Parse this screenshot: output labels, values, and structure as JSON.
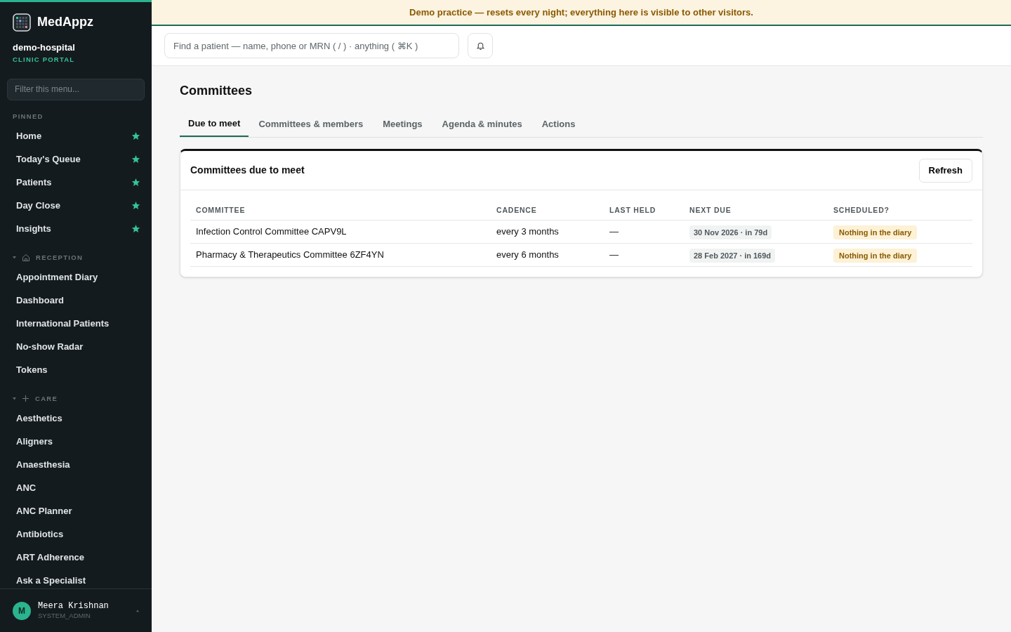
{
  "sidebar": {
    "brand": "MedAppz",
    "org": "demo-hospital",
    "portal": "CLINIC PORTAL",
    "filter": {
      "placeholder": "Filter this menu..."
    },
    "sections": [
      {
        "title": "PINNED",
        "kind": "pinned",
        "items": [
          {
            "label": "Home",
            "starred": true
          },
          {
            "label": "Today's Queue",
            "starred": true
          },
          {
            "label": "Patients",
            "starred": true
          },
          {
            "label": "Day Close",
            "starred": true
          },
          {
            "label": "Insights",
            "starred": true
          }
        ]
      },
      {
        "title": "RECEPTION",
        "kind": "group",
        "expanded": true,
        "items": [
          {
            "label": "Appointment Diary",
            "starred": false
          },
          {
            "label": "Dashboard",
            "starred": false
          },
          {
            "label": "International Patients",
            "starred": false
          },
          {
            "label": "No-show Radar",
            "starred": false
          },
          {
            "label": "Tokens",
            "starred": false
          }
        ]
      },
      {
        "title": "CARE",
        "kind": "group",
        "expanded": true,
        "items": [
          {
            "label": "Aesthetics",
            "starred": false
          },
          {
            "label": "Aligners",
            "starred": false
          },
          {
            "label": "Anaesthesia",
            "starred": false
          },
          {
            "label": "ANC",
            "starred": false
          },
          {
            "label": "ANC Planner",
            "starred": false
          },
          {
            "label": "Antibiotics",
            "starred": false
          },
          {
            "label": "ART Adherence",
            "starred": false
          },
          {
            "label": "Ask a Specialist",
            "starred": false
          }
        ]
      }
    ],
    "user": {
      "initial": "M",
      "name": "Meera Krishnan",
      "role": "SYSTEM_ADMIN"
    }
  },
  "banner": "Demo practice — resets every night; everything here is visible to other visitors.",
  "search": {
    "placeholder": "Find a patient — name, phone or MRN ( / ) · anything ( ⌘K )"
  },
  "page": {
    "title": "Committees",
    "tabs": [
      {
        "label": "Due to meet",
        "selected": true
      },
      {
        "label": "Committees & members",
        "selected": false
      },
      {
        "label": "Meetings",
        "selected": false
      },
      {
        "label": "Agenda & minutes",
        "selected": false
      },
      {
        "label": "Actions",
        "selected": false
      }
    ],
    "card": {
      "title": "Committees due to meet",
      "button": "Refresh",
      "table": {
        "columns": [
          "COMMITTEE",
          "CADENCE",
          "LAST HELD",
          "NEXT DUE",
          "SCHEDULED?"
        ],
        "rows": [
          {
            "committee": "Infection Control Committee CAPV9L",
            "cadence": "every 3 months",
            "last_held": "—",
            "next_due": "30 Nov 2026 · in 79d",
            "scheduled": "Nothing in the diary"
          },
          {
            "committee": "Pharmacy & Therapeutics Committee 6ZF4YN",
            "cadence": "every 6 months",
            "last_held": "—",
            "next_due": "28 Feb 2027 · in 169d",
            "scheduled": "Nothing in the diary"
          }
        ]
      }
    }
  }
}
